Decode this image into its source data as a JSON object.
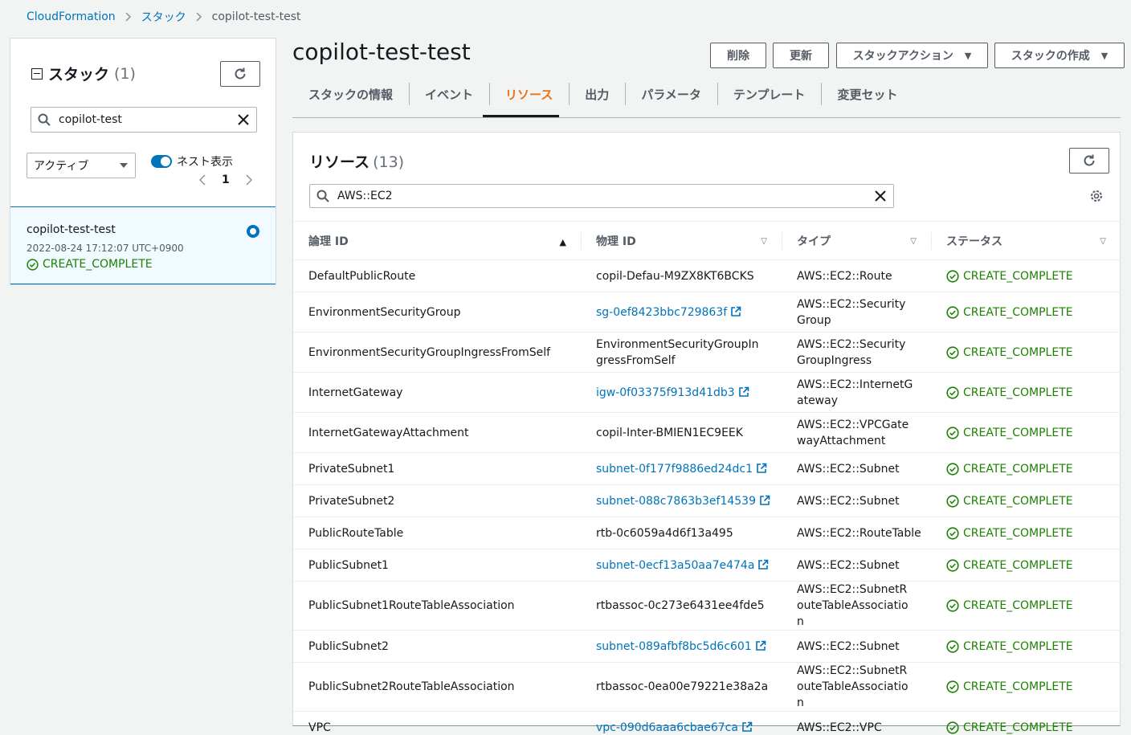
{
  "breadcrumb": {
    "root": "CloudFormation",
    "section": "スタック",
    "current": "copilot-test-test"
  },
  "stacks_panel": {
    "title": "スタック",
    "count": "(1)",
    "search_value": "copilot-test",
    "filter_selected": "アクティブ",
    "nested_toggle_label": "ネスト表示",
    "nested_toggle_on": true,
    "page": "1",
    "selected_stack": {
      "name": "copilot-test-test",
      "timestamp": "2022-08-24 17:12:07 UTC+0900",
      "status": "CREATE_COMPLETE"
    }
  },
  "header": {
    "title": "copilot-test-test",
    "buttons": {
      "delete": "削除",
      "update": "更新",
      "stack_actions": "スタックアクション",
      "create_stack": "スタックの作成"
    }
  },
  "tabs": [
    "スタックの情報",
    "イベント",
    "リソース",
    "出力",
    "パラメータ",
    "テンプレート",
    "変更セット"
  ],
  "active_tab": "リソース",
  "resources": {
    "title": "リソース",
    "count": "(13)",
    "search_value": "AWS::EC2",
    "columns": {
      "logical_id": "論理 ID",
      "physical_id": "物理 ID",
      "type": "タイプ",
      "status": "ステータス"
    },
    "rows": [
      {
        "logical_id": "DefaultPublicRoute",
        "physical_id": "copil-Defau-M9ZX8KT6BCKS",
        "type": "AWS::EC2::Route",
        "status": "CREATE_COMPLETE"
      },
      {
        "logical_id": "EnvironmentSecurityGroup",
        "physical_id": "sg-0ef8423bbc729863f",
        "type": "AWS::EC2::SecurityGroup",
        "status": "CREATE_COMPLETE"
      },
      {
        "logical_id": "EnvironmentSecurityGroupIngressFromSelf",
        "physical_id": "EnvironmentSecurityGroupIngressFromSelf",
        "type": "AWS::EC2::SecurityGroupIngress",
        "status": "CREATE_COMPLETE"
      },
      {
        "logical_id": "InternetGateway",
        "physical_id": "igw-0f03375f913d41db3",
        "type": "AWS::EC2::InternetGateway",
        "status": "CREATE_COMPLETE"
      },
      {
        "logical_id": "InternetGatewayAttachment",
        "physical_id": "copil-Inter-BMIEN1EC9EEK",
        "type": "AWS::EC2::VPCGatewayAttachment",
        "status": "CREATE_COMPLETE"
      },
      {
        "logical_id": "PrivateSubnet1",
        "physical_id": "subnet-0f177f9886ed24dc1",
        "type": "AWS::EC2::Subnet",
        "status": "CREATE_COMPLETE"
      },
      {
        "logical_id": "PrivateSubnet2",
        "physical_id": "subnet-088c7863b3ef14539",
        "type": "AWS::EC2::Subnet",
        "status": "CREATE_COMPLETE"
      },
      {
        "logical_id": "PublicRouteTable",
        "physical_id": "rtb-0c6059a4d6f13a495",
        "type": "AWS::EC2::RouteTable",
        "status": "CREATE_COMPLETE"
      },
      {
        "logical_id": "PublicSubnet1",
        "physical_id": "subnet-0ecf13a50aa7e474a",
        "type": "AWS::EC2::Subnet",
        "status": "CREATE_COMPLETE"
      },
      {
        "logical_id": "PublicSubnet1RouteTableAssociation",
        "physical_id": "rtbassoc-0c273e6431ee4fde5",
        "type": "AWS::EC2::SubnetRouteTableAssociation",
        "status": "CREATE_COMPLETE"
      },
      {
        "logical_id": "PublicSubnet2",
        "physical_id": "subnet-089afbf8bc5d6c601",
        "type": "AWS::EC2::Subnet",
        "status": "CREATE_COMPLETE"
      },
      {
        "logical_id": "PublicSubnet2RouteTableAssociation",
        "physical_id": "rtbassoc-0ea00e79221e38a2a",
        "type": "AWS::EC2::SubnetRouteTableAssociation",
        "status": "CREATE_COMPLETE"
      },
      {
        "logical_id": "VPC",
        "physical_id": "vpc-090d6aaa6cbae67ca",
        "type": "AWS::EC2::VPC",
        "status": "CREATE_COMPLETE"
      }
    ]
  },
  "colors": {
    "link": "#0073bb",
    "success": "#1d8102",
    "active_tab": "#ec7211"
  }
}
